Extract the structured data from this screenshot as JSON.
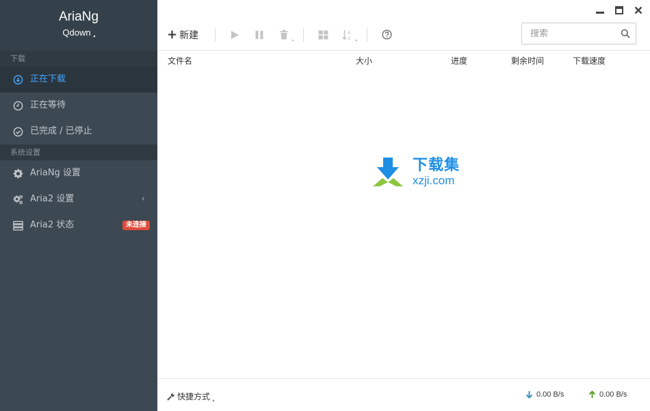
{
  "app": {
    "name": "AriaNg",
    "subtitle": "Qdown"
  },
  "sidebar": {
    "sections": [
      {
        "header": "下载"
      },
      {
        "header": "系统设置"
      }
    ],
    "download_items": [
      {
        "label": "正在下载",
        "icon": "download-circle-icon",
        "active": true
      },
      {
        "label": "正在等待",
        "icon": "clock-icon",
        "active": false
      },
      {
        "label": "已完成 / 已停止",
        "icon": "check-circle-icon",
        "active": false
      }
    ],
    "settings_items": [
      {
        "label": "AriaNg 设置",
        "icon": "gear-icon"
      },
      {
        "label": "Aria2 设置",
        "icon": "gears-icon",
        "chevron": "‹"
      },
      {
        "label": "Aria2 状态",
        "icon": "server-icon",
        "badge": "未连接"
      }
    ]
  },
  "toolbar": {
    "new_label": "新建",
    "search_placeholder": "搜索"
  },
  "table": {
    "columns": [
      "文件名",
      "大小",
      "进度",
      "剩余时间",
      "下载速度"
    ]
  },
  "watermark": {
    "cn": "下载集",
    "en": "xzji.com"
  },
  "footer": {
    "shortcut_label": "快捷方式",
    "download_speed": "0.00 B/s",
    "upload_speed": "0.00 B/s"
  },
  "colors": {
    "sidebar_bg": "#3c4852",
    "active_text": "#47a3f5",
    "badge_bg": "#dd4b39",
    "download_arrow": "#3c8dbc",
    "upload_arrow": "#5aa02c"
  }
}
